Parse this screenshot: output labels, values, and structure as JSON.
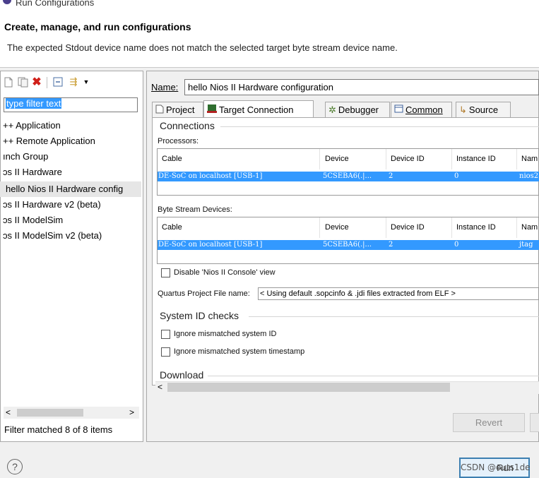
{
  "window": {
    "title": "Run Configurations"
  },
  "header": {
    "title": "Create, manage, and run configurations",
    "message": "The expected Stdout device name does not match the selected target byte stream device name."
  },
  "left": {
    "filter_text": "type filter text",
    "tree": [
      "++ Application",
      "++ Remote Application",
      "ınch Group",
      "ɔs II Hardware",
      "hello Nios II Hardware config",
      "ɔs II Hardware v2 (beta)",
      "ɔs II ModelSim",
      "ɔs II ModelSim v2 (beta)"
    ],
    "status": "Filter matched 8 of 8 items",
    "scroll_left": "<",
    "scroll_right": ">"
  },
  "right": {
    "name_label": "Name:",
    "name_value": "hello Nios II Hardware configuration",
    "tabs": [
      "Project",
      "Target Connection",
      "Debugger",
      "Common",
      "Source"
    ],
    "connections_title": "Connections",
    "processors_label": "Processors:",
    "table_headers": [
      "Cable",
      "Device",
      "Device ID",
      "Instance ID",
      "Nam"
    ],
    "processors_row": [
      "DE-SoC on localhost [USB-1]",
      "5CSEBA6(.|...",
      "2",
      "0",
      "nios2"
    ],
    "byte_stream_label": "Byte Stream Devices:",
    "byte_row": [
      "DE-SoC on localhost [USB-1]",
      "5CSEBA6(.|...",
      "2",
      "0",
      "jtag"
    ],
    "disable_console": "Disable 'Nios II Console' view",
    "quartus_label": "Quartus Project File name:",
    "quartus_value": "< Using default .sopcinfo & .jdi files extracted from ELF >",
    "sysid_title": "System ID checks",
    "ignore_id": "Ignore mismatched system ID",
    "ignore_timestamp": "Ignore mismatched system timestamp",
    "download_title": "Download",
    "scroll_left": "<"
  },
  "buttons": {
    "revert": "Revert",
    "run": "Run",
    "help": "?"
  },
  "watermark": "CSDN @outs1de"
}
